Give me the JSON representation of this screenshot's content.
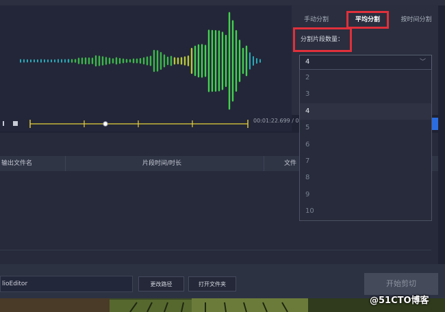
{
  "tabs": [
    {
      "label": "手动分割",
      "active": false
    },
    {
      "label": "平均分割",
      "active": true
    },
    {
      "label": "按时间分割",
      "active": false
    }
  ],
  "segment": {
    "label": "分割片段数量：",
    "value": "4",
    "options": [
      "2",
      "3",
      "4",
      "5",
      "6",
      "7",
      "8",
      "9",
      "10"
    ]
  },
  "player": {
    "time_current": "00:01:22.699",
    "time_sep": "/ 0"
  },
  "table": {
    "columns": [
      "输出文件名",
      "片段时间/时长",
      "文件"
    ]
  },
  "bottom": {
    "path_value": "lioEditor",
    "change_path": "更改路径",
    "open_folder": "打开文件夹",
    "start_cut": "开始剪切"
  },
  "watermark": "@51CTO博客",
  "colors": {
    "highlight": "#e0303b",
    "accent_blue": "#2b6de0",
    "timeline_yellow": "#e8d23a"
  }
}
